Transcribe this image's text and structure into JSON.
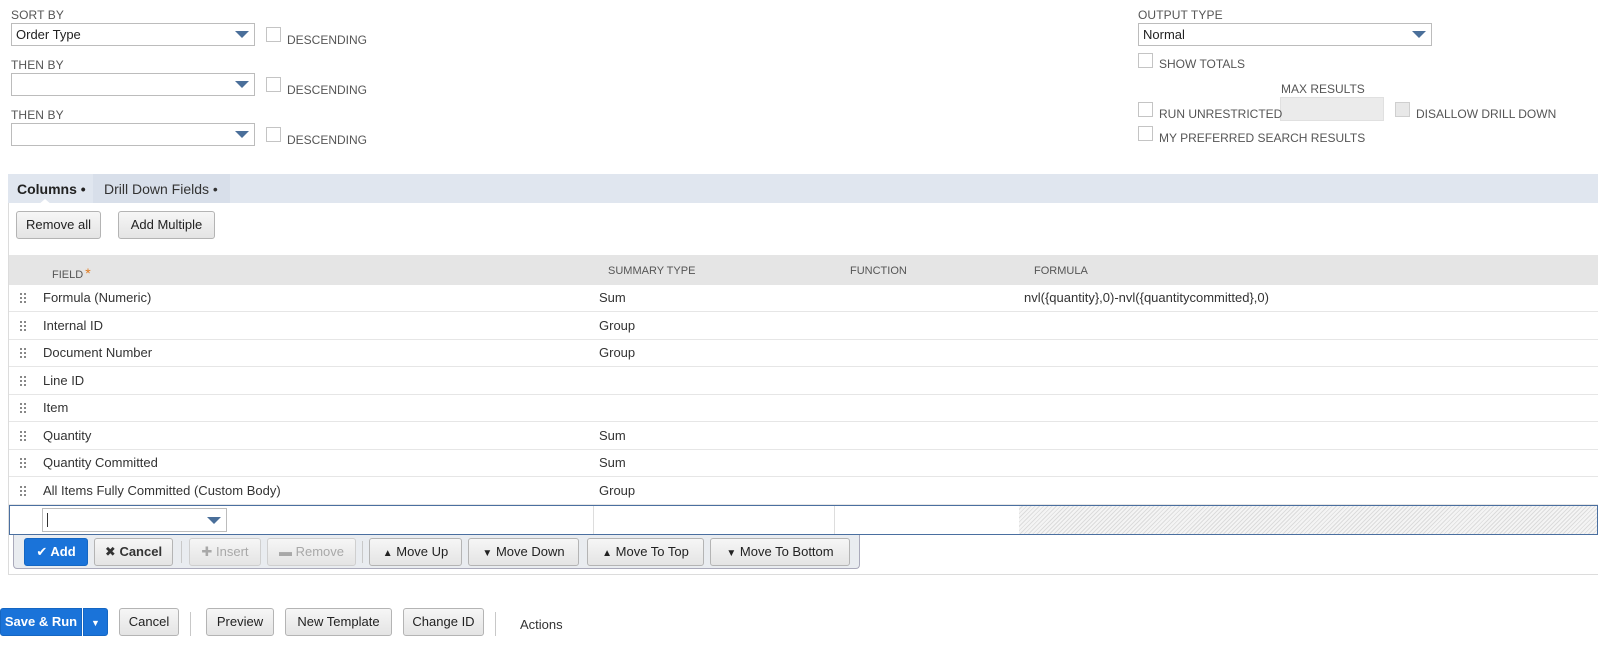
{
  "sort": {
    "sort_by_label": "SORT BY",
    "sort_by_value": "Order Type",
    "then_by_label_1": "THEN BY",
    "then_by_value_1": "",
    "then_by_label_2": "THEN BY",
    "then_by_value_2": "",
    "descending_label": "DESCENDING"
  },
  "output": {
    "output_type_label": "OUTPUT TYPE",
    "output_type_value": "Normal",
    "show_totals_label": "SHOW TOTALS",
    "max_results_label": "MAX RESULTS",
    "run_unrestricted_label": "RUN UNRESTRICTED",
    "disallow_drill_down_label": "DISALLOW DRILL DOWN",
    "my_preferred_label": "MY PREFERRED SEARCH RESULTS"
  },
  "tabs": [
    {
      "label": "Columns •",
      "active": true
    },
    {
      "label": "Drill Down Fields •",
      "active": false
    }
  ],
  "panel_buttons": {
    "remove_all": "Remove all",
    "add_multiple": "Add Multiple"
  },
  "table": {
    "headers": {
      "field": "FIELD",
      "required": "*",
      "summary_type": "SUMMARY TYPE",
      "function": "FUNCTION",
      "formula": "FORMULA"
    },
    "rows": [
      {
        "field": "Formula (Numeric)",
        "summary": "Sum",
        "function": "",
        "formula": "nvl({quantity},0)-nvl({quantitycommitted},0)"
      },
      {
        "field": "Internal ID",
        "summary": "Group",
        "function": "",
        "formula": ""
      },
      {
        "field": "Document Number",
        "summary": "Group",
        "function": "",
        "formula": ""
      },
      {
        "field": "Line ID",
        "summary": "",
        "function": "",
        "formula": ""
      },
      {
        "field": "Item",
        "summary": "",
        "function": "",
        "formula": ""
      },
      {
        "field": "Quantity",
        "summary": "Sum",
        "function": "",
        "formula": ""
      },
      {
        "field": "Quantity Committed",
        "summary": "Sum",
        "function": "",
        "formula": ""
      },
      {
        "field": "All Items Fully Committed (Custom Body)",
        "summary": "Group",
        "function": "",
        "formula": ""
      }
    ]
  },
  "edit_toolbar": {
    "add": "Add",
    "cancel": "Cancel",
    "insert": "Insert",
    "remove": "Remove",
    "move_up": "Move Up",
    "move_down": "Move Down",
    "move_to_top": "Move To Top",
    "move_to_bottom": "Move To Bottom"
  },
  "footer": {
    "save_run": "Save & Run",
    "cancel": "Cancel",
    "preview": "Preview",
    "new_template": "New Template",
    "change_id": "Change ID",
    "actions": "Actions"
  },
  "colors": {
    "primary_blue": "#1a73d9",
    "tab_bg": "#e0e6ef",
    "caret": "#4a6f9a",
    "required_star": "#e07a1f"
  }
}
